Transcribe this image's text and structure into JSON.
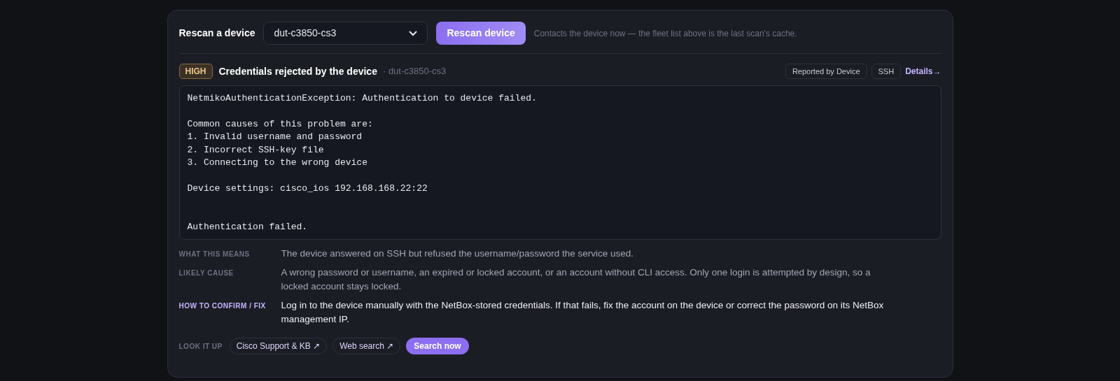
{
  "rescan": {
    "label": "Rescan a device",
    "device": "dut-c3850-cs3",
    "button": "Rescan device",
    "hint": "Contacts the device now — the fleet list above is the last scan's cache."
  },
  "finding": {
    "severity": "HIGH",
    "title": "Credentials rejected by the device",
    "device": "· dut-c3850-cs3",
    "tags": [
      "Reported by Device",
      "SSH"
    ],
    "details_link": "Details→"
  },
  "log": "NetmikoAuthenticationException: Authentication to device failed.\n\nCommon causes of this problem are:\n1. Invalid username and password\n2. Incorrect SSH-key file\n3. Connecting to the wrong device\n\nDevice settings: cisco_ios 192.168.168.22:22\n\n\nAuthentication failed.",
  "info": [
    {
      "label": "WHAT THIS MEANS",
      "text": "The device answered on SSH but refused the username/password the service used.",
      "emphasis": false
    },
    {
      "label": "LIKELY CAUSE",
      "text": "A wrong password or username, an expired or locked account, or an account without CLI access. Only one login is attempted by design, so a locked account stays locked.",
      "emphasis": false
    },
    {
      "label": "HOW TO CONFIRM / FIX",
      "text": "Log in to the device manually with the NetBox-stored credentials. If that fails, fix the account on the device or correct the password on its NetBox management IP.",
      "emphasis": true
    }
  ],
  "lookup": {
    "label": "LOOK IT UP",
    "actions": [
      {
        "kind": "link",
        "label": "Cisco Support & KB ↗"
      },
      {
        "kind": "link",
        "label": "Web search ↗"
      },
      {
        "kind": "button",
        "label": "Search now"
      }
    ]
  }
}
